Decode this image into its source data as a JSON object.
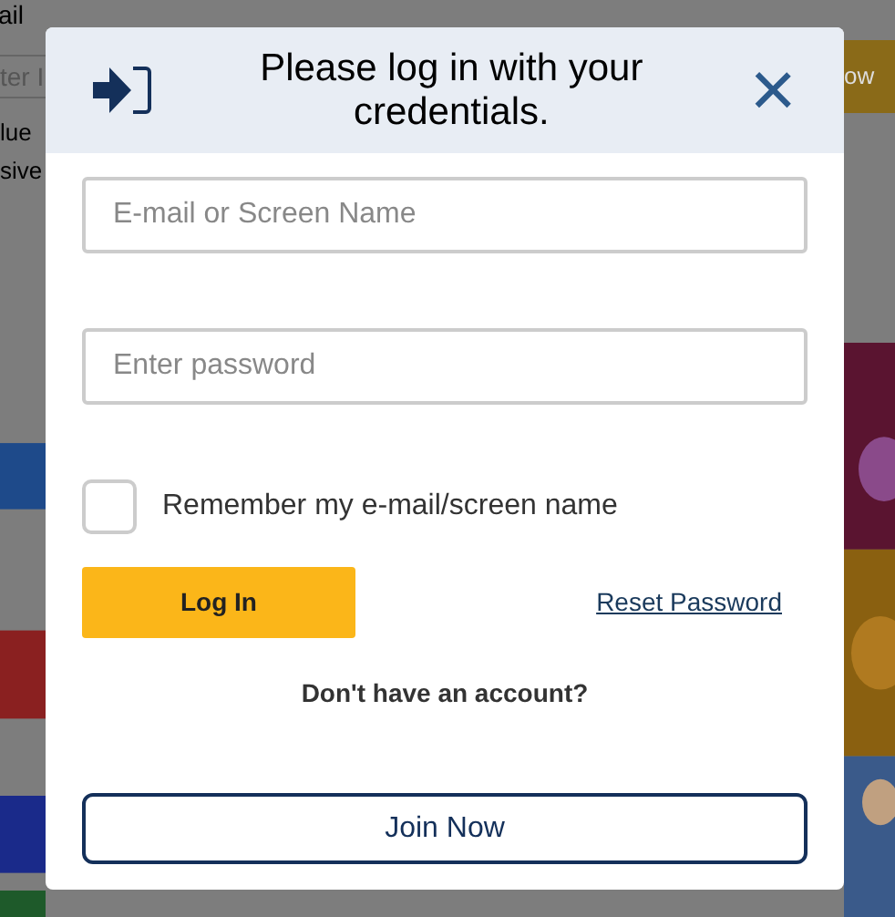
{
  "background_page": {
    "label": "ail",
    "field": {
      "placeholder": "ter I"
    },
    "note_lines": [
      "lue",
      "sive"
    ],
    "button": "ow"
  },
  "dialog": {
    "title": "Please log in with your credentials.",
    "close": "×",
    "email_field": {
      "placeholder": "E-mail or Screen Name"
    },
    "password_field": {
      "placeholder": "Enter password"
    },
    "remember": {
      "label": "Remember my e-mail/screen name",
      "checked": false
    },
    "login_button": "Log In",
    "reset_link": "Reset Password",
    "signup_prompt": "Don't have an account?",
    "join_button": "Join Now"
  }
}
